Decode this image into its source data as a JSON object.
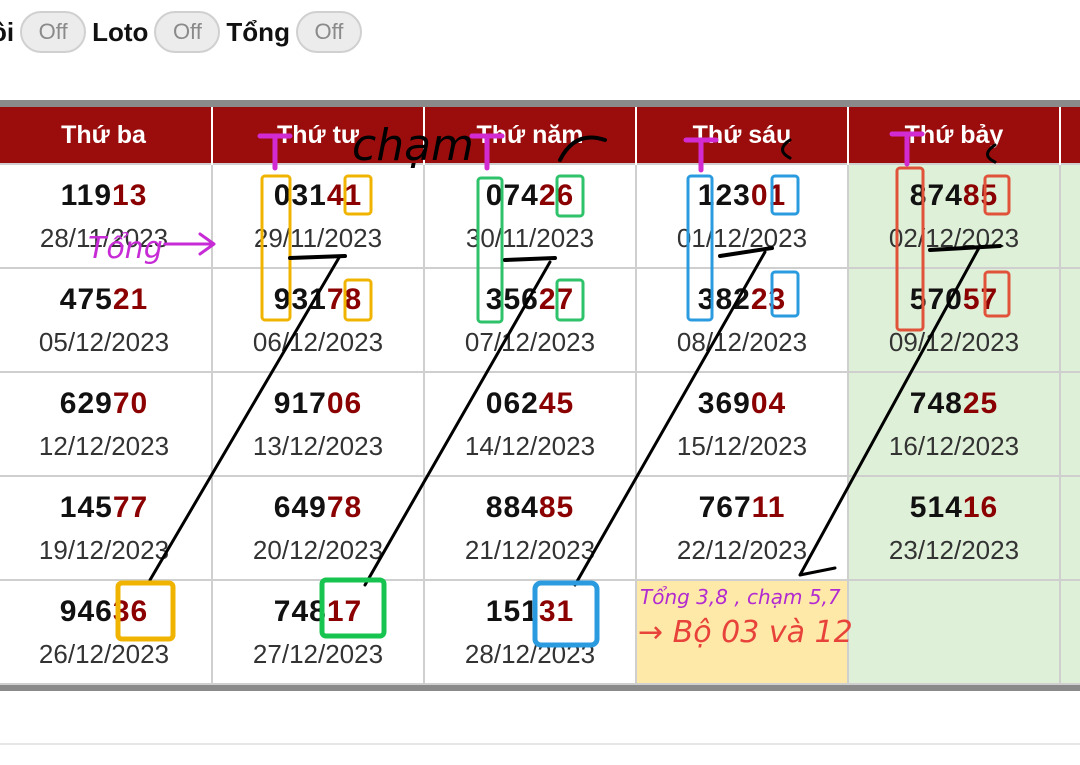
{
  "filters": [
    {
      "label": "ôi",
      "state": "Off"
    },
    {
      "label": "Loto",
      "state": "Off"
    },
    {
      "label": "Tổng",
      "state": "Off"
    }
  ],
  "headers": [
    "Thứ ba",
    "Thứ tư",
    "Thứ năm",
    "Thứ sáu",
    "Thứ bảy"
  ],
  "rows": [
    [
      {
        "head": "119",
        "tail": "13",
        "date": "28/11/2023"
      },
      {
        "head": "031",
        "tail": "41",
        "date": "29/11/2023"
      },
      {
        "head": "074",
        "tail": "26",
        "date": "30/11/2023"
      },
      {
        "head": "123",
        "tail": "01",
        "date": "01/12/2023"
      },
      {
        "head": "874",
        "tail": "85",
        "date": "02/12/2023"
      }
    ],
    [
      {
        "head": "475",
        "tail": "21",
        "date": "05/12/2023"
      },
      {
        "head": "931",
        "tail": "78",
        "date": "06/12/2023"
      },
      {
        "head": "356",
        "tail": "27",
        "date": "07/12/2023"
      },
      {
        "head": "382",
        "tail": "23",
        "date": "08/12/2023"
      },
      {
        "head": "570",
        "tail": "57",
        "date": "09/12/2023"
      }
    ],
    [
      {
        "head": "629",
        "tail": "70",
        "date": "12/12/2023"
      },
      {
        "head": "917",
        "tail": "06",
        "date": "13/12/2023"
      },
      {
        "head": "062",
        "tail": "45",
        "date": "14/12/2023"
      },
      {
        "head": "369",
        "tail": "04",
        "date": "15/12/2023"
      },
      {
        "head": "748",
        "tail": "25",
        "date": "16/12/2023"
      }
    ],
    [
      {
        "head": "145",
        "tail": "77",
        "date": "19/12/2023"
      },
      {
        "head": "649",
        "tail": "78",
        "date": "20/12/2023"
      },
      {
        "head": "884",
        "tail": "85",
        "date": "21/12/2023"
      },
      {
        "head": "767",
        "tail": "11",
        "date": "22/12/2023"
      },
      {
        "head": "514",
        "tail": "16",
        "date": "23/12/2023"
      }
    ],
    [
      {
        "head": "946",
        "tail": "36",
        "date": "26/12/2023"
      },
      {
        "head": "748",
        "tail": "17",
        "date": "27/12/2023"
      },
      {
        "head": "151",
        "tail": "31",
        "date": "28/12/2023"
      },
      null,
      null
    ]
  ],
  "annotations": {
    "cham": "chạm",
    "tong": "Tổng",
    "note_line1": "Tổng 3,8 , chạm 5,7",
    "note_line2": "→ Bộ 03 và 12"
  },
  "colors": {
    "header_bg": "#9b0d0d",
    "tail_digits": "#8b0000",
    "saturday_bg": "#dff0d8",
    "highlight_bg": "#ffe9a8"
  }
}
